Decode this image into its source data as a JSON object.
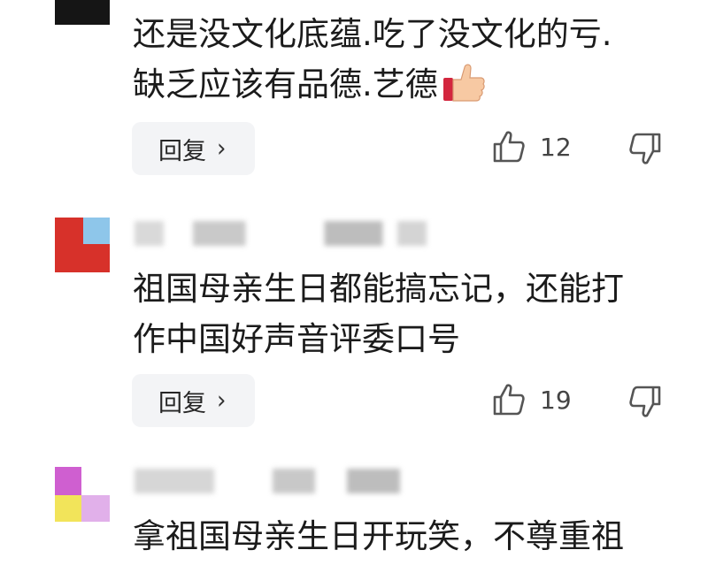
{
  "comments": [
    {
      "text_lines": [
        "还是没文化底蕴.吃了没文化的亏.",
        "缺乏应该有品德.艺德"
      ],
      "reply_label": "回复",
      "likes": "12"
    },
    {
      "text_lines": [
        "祖国母亲生日都能搞忘记，还能打",
        "作中国好声音评委口号"
      ],
      "reply_label": "回复",
      "likes": "19"
    },
    {
      "text_lines": [
        "拿祖国母亲生日开玩笑，不尊重祖"
      ]
    }
  ],
  "icons": {
    "like": "thumbs-up-outline-icon",
    "dislike": "thumbs-down-outline-icon",
    "emoji": "thumbs-up-emoji",
    "chevron": "chevron-right-icon"
  },
  "colors": {
    "avatar2_red": "#d7312a",
    "avatar2_blue": "#8ec6ea",
    "avatar3_magenta": "#cf5fd0",
    "avatar3_yellow": "#f2e45a",
    "reply_bg": "#f3f4f6"
  }
}
